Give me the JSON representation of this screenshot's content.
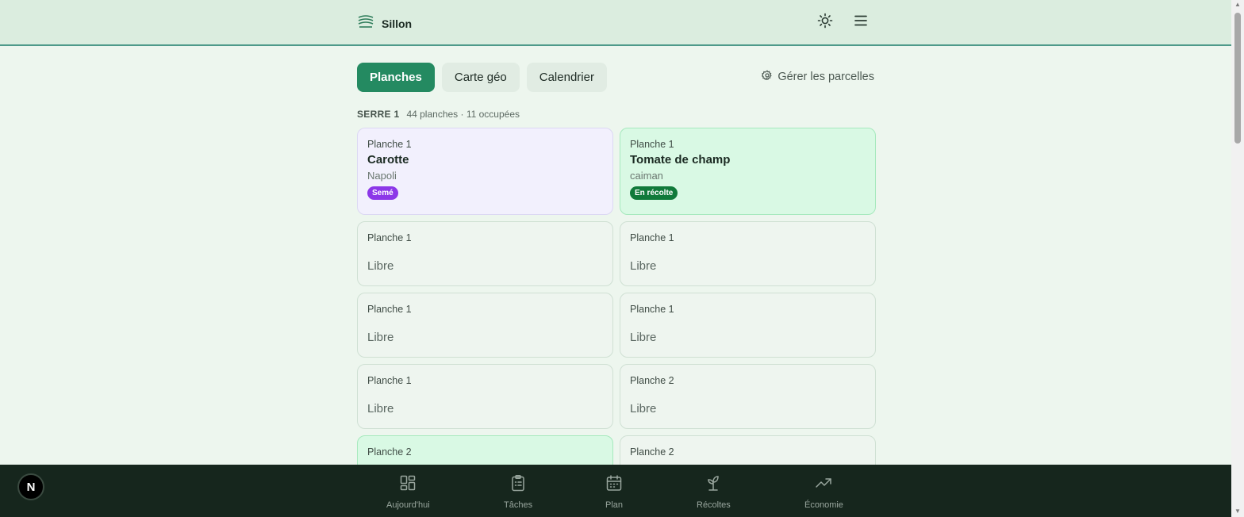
{
  "header": {
    "brand": "Sillon",
    "theme_icon": "sun-icon",
    "menu_icon": "hamburger-menu-icon"
  },
  "tabs": [
    {
      "label": "Planches",
      "active": true
    },
    {
      "label": "Carte géo",
      "active": false
    },
    {
      "label": "Calendrier",
      "active": false
    }
  ],
  "manage_label": "Gérer les parcelles",
  "section": {
    "name": "SERRE 1",
    "meta": "44 planches · 11 occupées"
  },
  "cards": [
    {
      "label": "Planche 1",
      "crop": "Carotte",
      "variety": "Napoli",
      "badge": "Semé",
      "status": "sown"
    },
    {
      "label": "Planche 1",
      "crop": "Tomate de champ",
      "variety": "caiman",
      "badge": "En récolte",
      "status": "harvest"
    },
    {
      "label": "Planche 1",
      "free": "Libre"
    },
    {
      "label": "Planche 1",
      "free": "Libre"
    },
    {
      "label": "Planche 1",
      "free": "Libre"
    },
    {
      "label": "Planche 1",
      "free": "Libre"
    },
    {
      "label": "Planche 1",
      "free": "Libre"
    },
    {
      "label": "Planche 2",
      "free": "Libre"
    },
    {
      "label": "Planche 2",
      "status": "harvest"
    },
    {
      "label": "Planche 2"
    }
  ],
  "bottom_nav": [
    {
      "label": "Aujourd'hui",
      "icon": "dashboard-grid-icon"
    },
    {
      "label": "Tâches",
      "icon": "clipboard-list-icon"
    },
    {
      "label": "Plan",
      "icon": "calendar-icon"
    },
    {
      "label": "Récoltes",
      "icon": "sprout-icon"
    },
    {
      "label": "Économie",
      "icon": "trending-up-icon"
    }
  ],
  "dev_badge": "N",
  "colors": {
    "accent": "#248a61",
    "header_bg": "#dbeddf",
    "page_bg": "#edf6ee",
    "nav_bg": "#16261d",
    "sown_badge": "#8c37e8",
    "harvest_badge": "#107a3a"
  }
}
